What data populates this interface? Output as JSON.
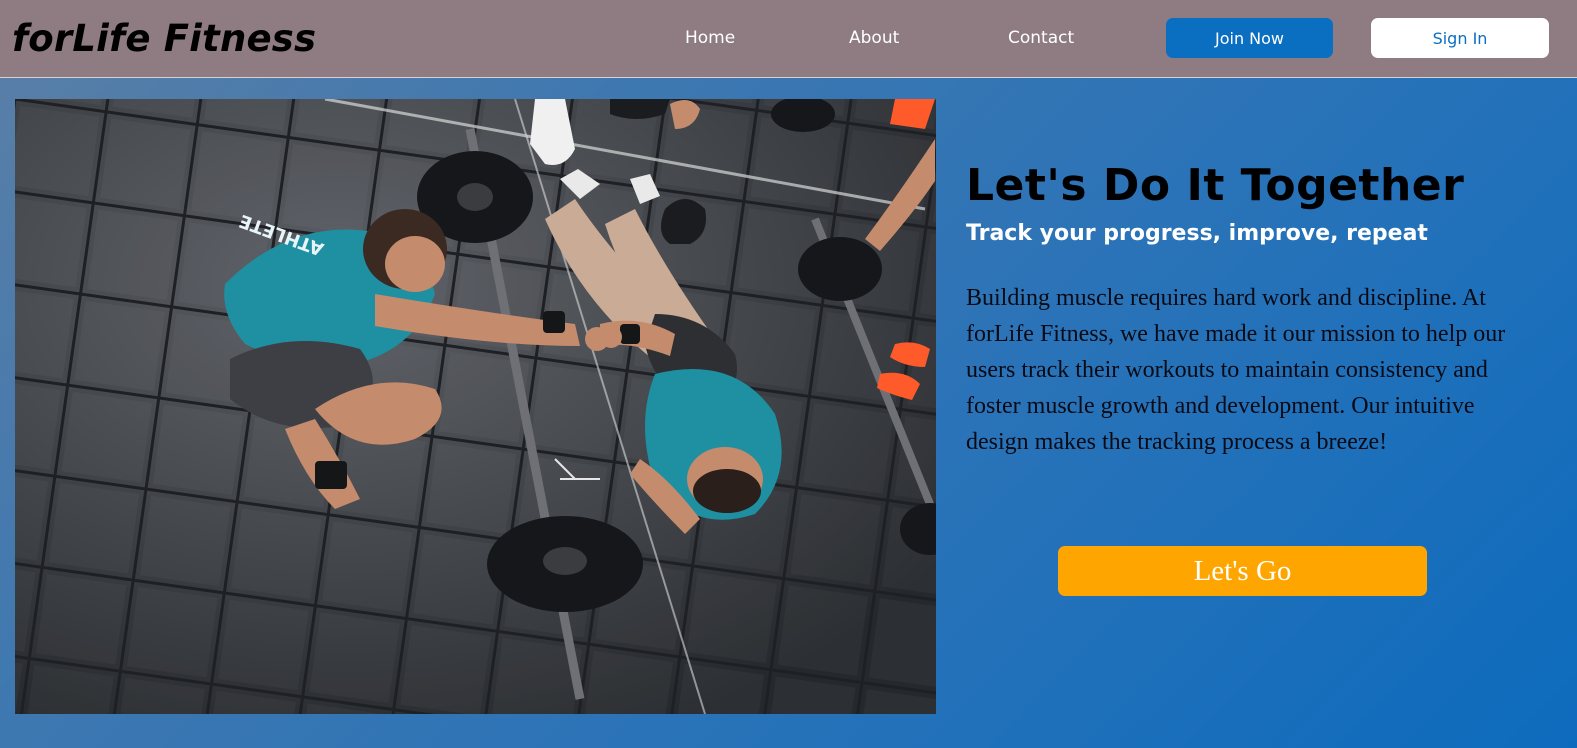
{
  "navbar": {
    "brand": "forLife Fitness",
    "links": [
      {
        "label": "Home"
      },
      {
        "label": "About"
      },
      {
        "label": "Contact"
      }
    ],
    "join_label": "Join Now",
    "signin_label": "Sign In"
  },
  "hero": {
    "title": "Let's Do It Together",
    "subtitle": "Track your progress, improve, repeat",
    "body": "Building muscle requires hard work and discipline. At forLife Fitness, we have made it our mission to help our users track their workouts to maintain consistency and foster muscle growth and development. Our intuitive design makes the tracking process a breeze!",
    "cta_label": "Let's Go",
    "image_shirt_text": "ATHLETE"
  },
  "colors": {
    "navbar_bg": "#8e7c82",
    "primary_blue": "#0b6fc1",
    "cta_orange": "#ffa500",
    "teal_shirt": "#1f8fa2"
  }
}
